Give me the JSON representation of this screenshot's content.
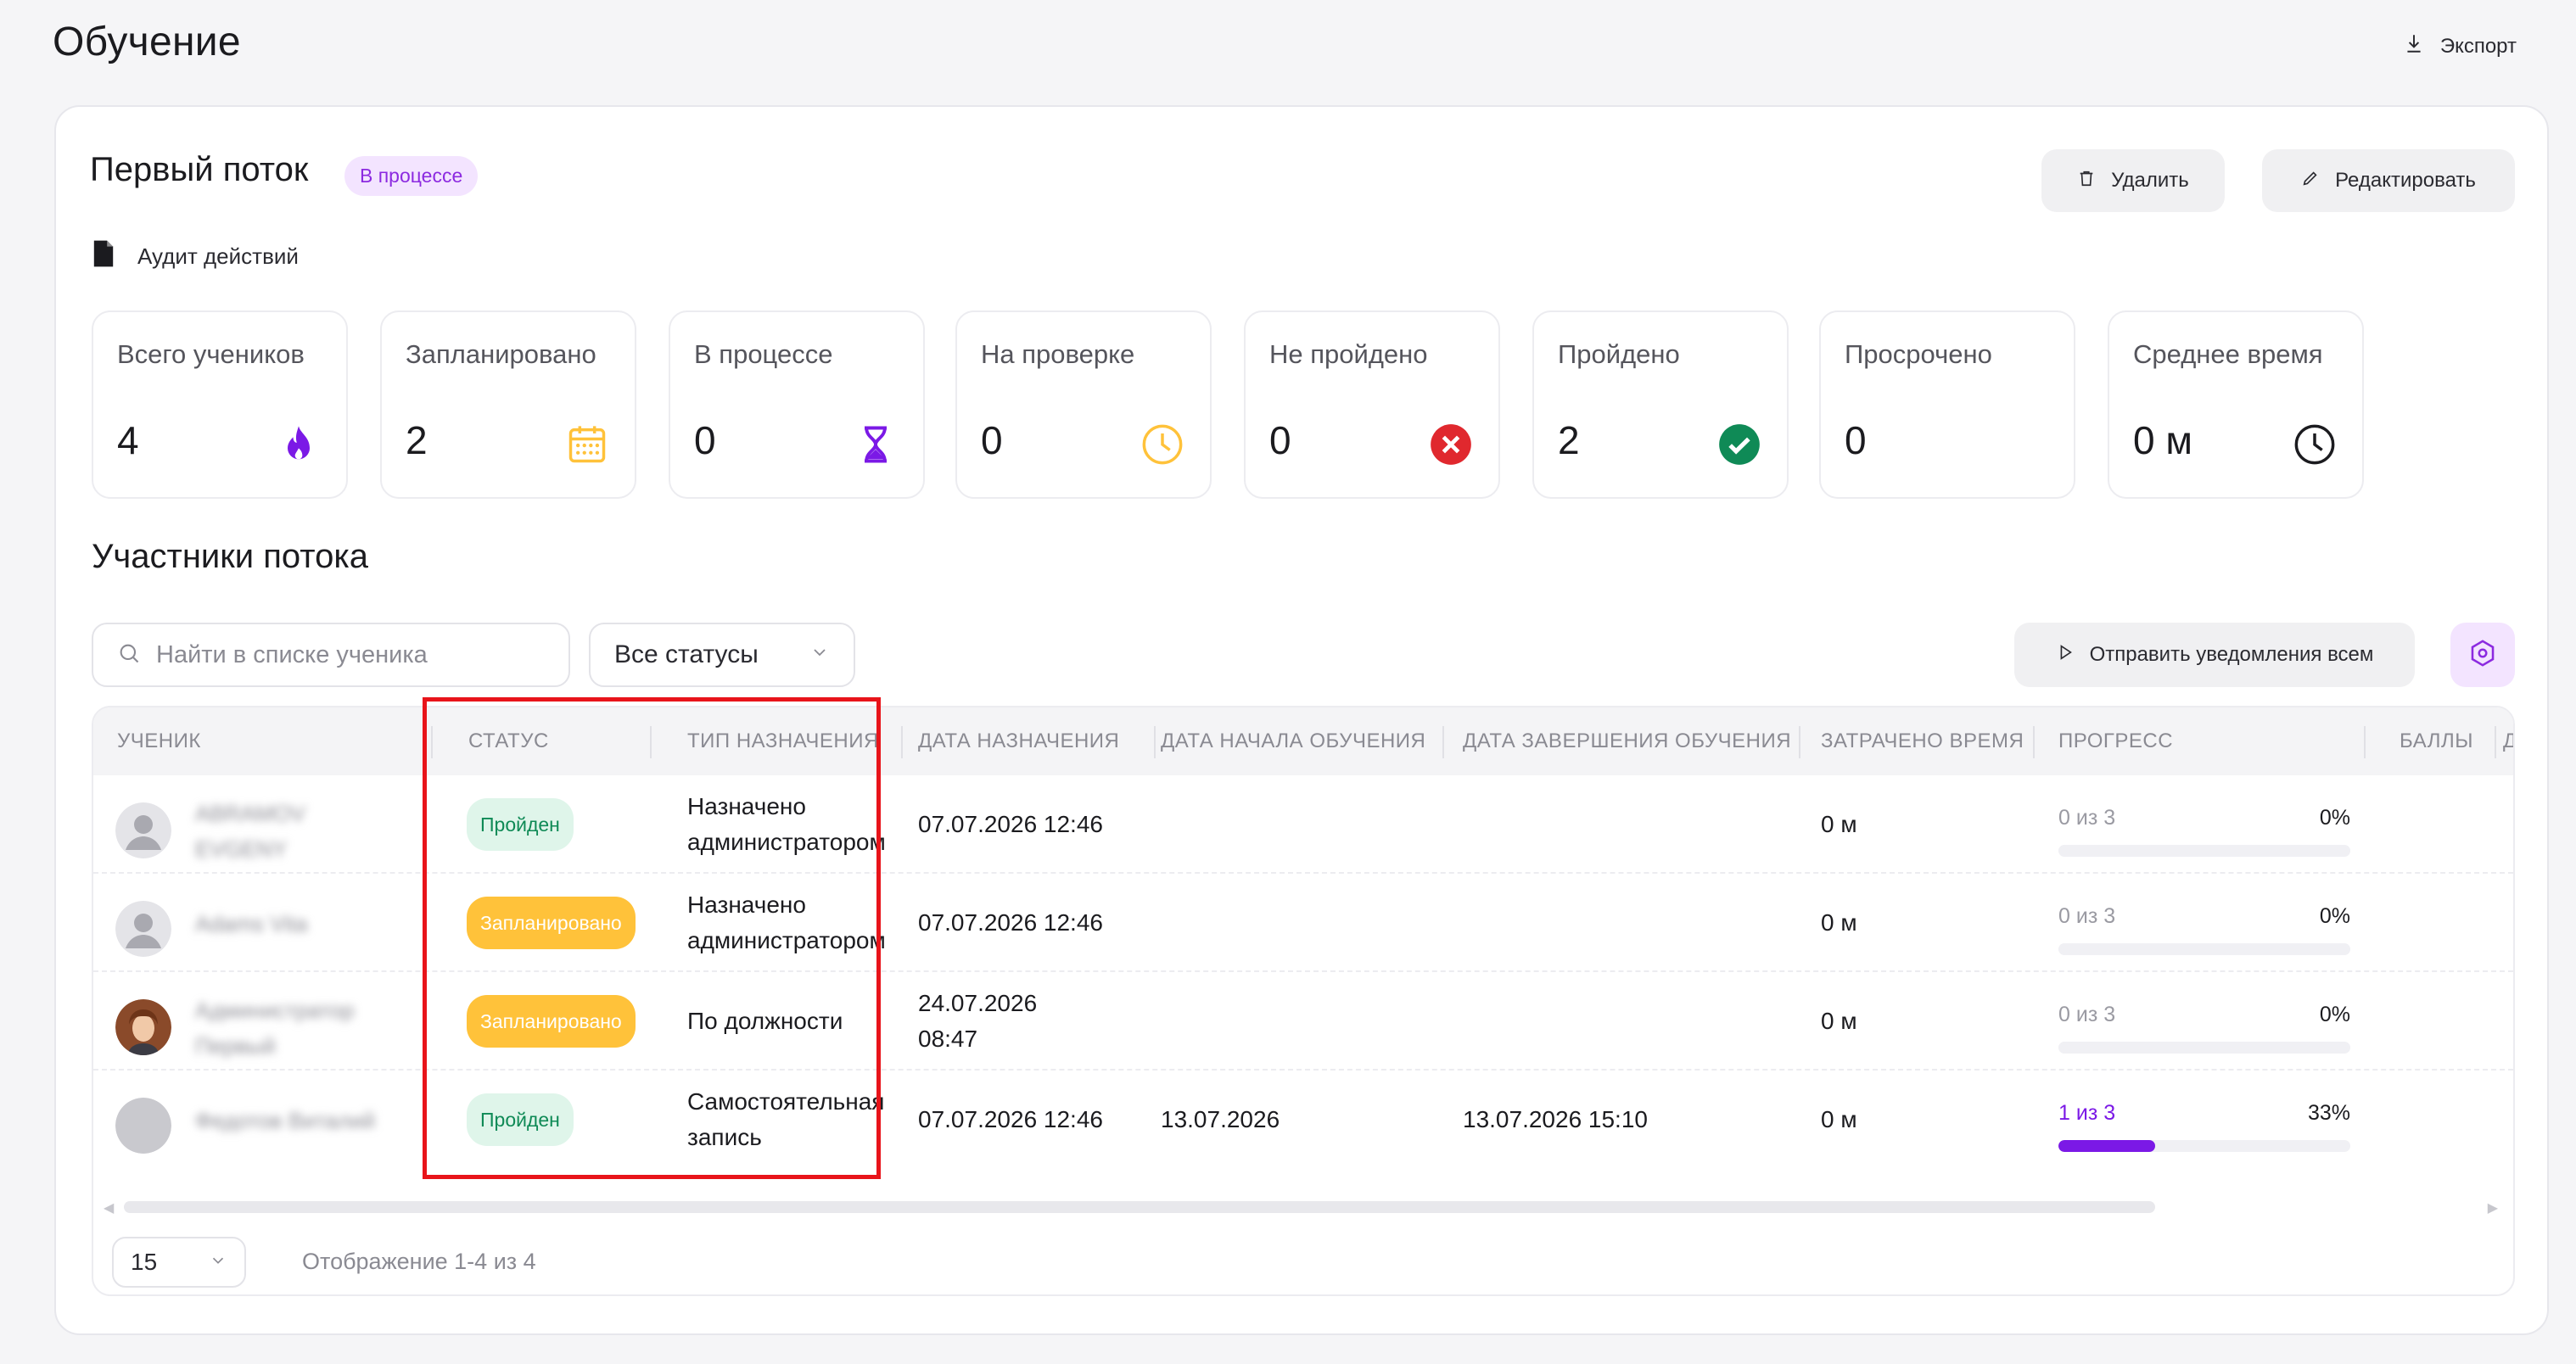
{
  "page": {
    "title": "Обучение",
    "export_label": "Экспорт"
  },
  "flow": {
    "title": "Первый поток",
    "status_badge": "В процессе",
    "delete_label": "Удалить",
    "edit_label": "Редактировать",
    "audit_label": "Аудит действий"
  },
  "stats": [
    {
      "label": "Всего учеников",
      "value": "4",
      "icon": "fire-icon",
      "color": "#7b19e6"
    },
    {
      "label": "Запланировано",
      "value": "2",
      "icon": "calendar-icon",
      "color": "#ffc23a"
    },
    {
      "label": "В процессе",
      "value": "0",
      "icon": "hourglass-icon",
      "color": "#7b19e6"
    },
    {
      "label": "На проверке",
      "value": "0",
      "icon": "clock-icon",
      "color": "#ffc23a"
    },
    {
      "label": "Не пройдено",
      "value": "0",
      "icon": "x-circle-icon",
      "color": "#e0282e"
    },
    {
      "label": "Пройдено",
      "value": "2",
      "icon": "check-circle-icon",
      "color": "#0f8a56"
    },
    {
      "label": "Просрочено",
      "value": "0",
      "icon": "",
      "color": ""
    },
    {
      "label": "Среднее время",
      "value": "0 м",
      "icon": "clock-outline-icon",
      "color": "#1b1b1f"
    }
  ],
  "participants": {
    "title": "Участники потока",
    "search_placeholder": "Найти в списке ученика",
    "status_filter": "Все статусы",
    "notify_label": "Отправить уведомления всем",
    "columns": [
      "УЧЕНИК",
      "СТАТУС",
      "ТИП НАЗНАЧЕНИЯ",
      "ДАТА НАЗНАЧЕНИЯ",
      "ДАТА НАЧАЛА ОБУЧЕНИЯ",
      "ДАТА ЗАВЕРШЕНИЯ ОБУЧЕНИЯ",
      "ЗАТРАЧЕНО ВРЕМЯ",
      "ПРОГРЕСС",
      "БАЛЛЫ",
      "Д"
    ],
    "rows": [
      {
        "name": "ABRAMOV EVGENY",
        "status": "Пройден",
        "status_kind": "done",
        "assign_type": "Назначено администратором",
        "assign_date": "07.07.2026 12:46",
        "start_date": "",
        "end_date": "",
        "time_spent": "0 м",
        "progress_text": "0 из 3",
        "progress_pct": "0%",
        "progress": 0,
        "avatar": "default"
      },
      {
        "name": "Adams Vita",
        "status": "Запланировано",
        "status_kind": "plan",
        "assign_type": "Назначено администратором",
        "assign_date": "07.07.2026 12:46",
        "start_date": "",
        "end_date": "",
        "time_spent": "0 м",
        "progress_text": "0 из 3",
        "progress_pct": "0%",
        "progress": 0,
        "avatar": "default"
      },
      {
        "name": "Администратор Первый",
        "status": "Запланировано",
        "status_kind": "plan",
        "assign_type": "По должности",
        "assign_date": "24.07.2026 08:47",
        "start_date": "",
        "end_date": "",
        "time_spent": "0 м",
        "progress_text": "0 из 3",
        "progress_pct": "0%",
        "progress": 0,
        "avatar": "photo"
      },
      {
        "name": "Федотов Виталий",
        "status": "Пройден",
        "status_kind": "done",
        "assign_type": "Самостоятельная запись",
        "assign_date": "07.07.2026 12:46",
        "start_date": "13.07.2026",
        "end_date": "13.07.2026 15:10",
        "time_spent": "0 м",
        "progress_text": "1 из 3",
        "progress_pct": "33%",
        "progress": 0.33,
        "avatar": "blank"
      }
    ],
    "per_page": "15",
    "showing": "Отображение 1-4 из 4"
  },
  "colors": {
    "accent": "#7b19e6",
    "badge_bg": "#f3e4ff",
    "done_bg": "#dff5ea",
    "done_text": "#0f8a56",
    "plan_bg": "#ffc23a",
    "highlight": "#e8141a"
  }
}
